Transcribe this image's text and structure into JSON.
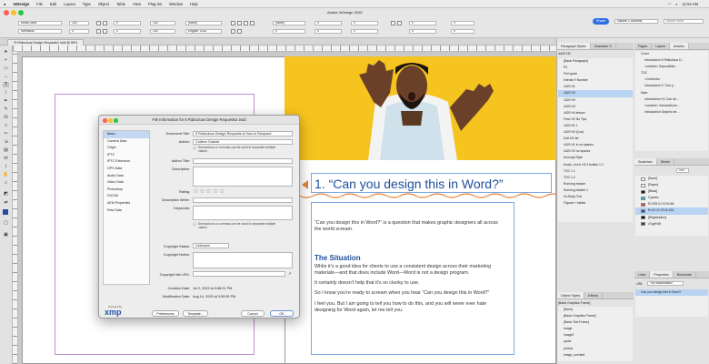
{
  "menubar": {
    "app": "InDesign",
    "items": [
      "File",
      "Edit",
      "Layout",
      "Type",
      "Object",
      "Table",
      "View",
      "Plug-ins",
      "Window",
      "Help"
    ],
    "time": "11:52 AM"
  },
  "control": {
    "title": "Adobe InDesign 2025",
    "font": "Mona Sans",
    "style": "SemiBold",
    "size": "100",
    "leading": "0",
    "lang": "English: USA",
    "none": "[None]",
    "zero": "0",
    "share": "Share",
    "search_ph": "Adobe Stock",
    "workspace": "column 2 columns"
  },
  "doc": {
    "tab": "*5 Ridiculous Design Requests2.indd @ 89%"
  },
  "canvas": {
    "heading": "1. “Can you design this in Word?”",
    "p1a": "“Can you design this in Word?” is a question that makes graphic designers all across",
    "p1b": "the world scream.",
    "subhead": "The Situation",
    "p2a": "While it’s a good idea for clients to use a consistent design across their marketing",
    "p2b": "materials—and that does include Word—Word is not a design program.",
    "p3": "It certainly doesn’t help that it’s so clunky to use.",
    "p4": "So I know you’re ready to scream when you hear “Can you design this in Word?”",
    "p5a": "I feel you. But I am going to tell you how to do this, and you will never ever hate",
    "p5b": "designing for Word again, let me tell you."
  },
  "pstyles": {
    "tabs": [
      "Paragraph Styles",
      "Character S"
    ],
    "header": "4420 H2",
    "items": [
      "[Basic Paragraph]",
      "P4",
      "Pull quote",
      "Interlat H Number",
      "4420 H1",
      "4420 H2",
      "4420 H3",
      "4420 H4",
      "4420 H4 lesson",
      "Fuse H2 No Tips",
      "4420 H1 1",
      "4420 H2 (Con)",
      "Dolt H2 list",
      "4420 H1 in no spaces",
      "4420 H2 no spaces",
      "Koncopt Style",
      "Kuals, List in H3 4 bullets 1.2",
      "TOC 1.1",
      "TOC 1.2",
      "Running header",
      "Running header 1",
      "Ho Body Text",
      "Figures + tables"
    ],
    "selected": 5
  },
  "pages": {
    "tabs": [
      "Pages",
      "Layers",
      "Articles"
    ],
    "items": [
      "Cover",
      "Introduction 5 Ridiculous D...",
      "<content> DepositAbe...",
      "TOC",
      "<Contents>",
      "Introduction 5 \"Can y...",
      "Main",
      "Introduction H1 Can de...",
      "<content> Introductione...",
      "Introduction Graphic de..."
    ]
  },
  "swatches": {
    "tabs": [
      "Swatches",
      "Stroke"
    ],
    "tint": "100",
    "items": [
      {
        "name": "[None]",
        "color": "#ffffff"
      },
      {
        "name": "[Paper]",
        "color": "#ffffff"
      },
      {
        "name": "[Black]",
        "color": "#111111"
      },
      {
        "name": "Cyanes",
        "color": "#22b2c9"
      },
      {
        "name": "R=235 G=70 B=65",
        "color": "#eb4641"
      },
      {
        "name": "R=42 G=75 B=162",
        "color": "#2a4ba2"
      },
      {
        "name": "[Registration]",
        "color": "#000000"
      },
      {
        "name": "oTygRnB",
        "color": "#3b3b3b"
      }
    ],
    "selected": 5
  },
  "props": {
    "tabs": [
      "Links",
      "Properties",
      "Bookmark"
    ],
    "url_label": "URL",
    "url_value": "<no bookmarks>",
    "item": "Can you design this in Word?"
  },
  "ostyles": {
    "tabs": [
      "Object Styles",
      "Effects"
    ],
    "header": "[Basic Graphics Frame]",
    "items": [
      "[None]",
      "[Basic Graphics Frame]",
      "[Basic Text Frame]",
      "Image",
      "Image2",
      "quote",
      "photos",
      "image_overlaid"
    ]
  },
  "dialog": {
    "title": "File Information for 5 Ridiculous Design Requests2.indd",
    "sidebar": [
      "Basic",
      "Camera Data",
      "Origin",
      "IPTC",
      "IPTC Extension",
      "GPS Data",
      "Audio Data",
      "Video Data",
      "Photoshop",
      "DICOM",
      "AEM Properties",
      "Raw Data"
    ],
    "labels": {
      "doc_title": "Document Title:",
      "author": "Author:",
      "author_title": "Author Title:",
      "description": "Description:",
      "rating": "Rating:",
      "desc_writer": "Description Writer:",
      "keywords": "Keywords:",
      "copyright_status": "Copyright Status:",
      "copyright_notice": "Copyright Notice:",
      "copyright_url": "Copyright Info URL:",
      "created": "Creation Date:",
      "modified": "Modification Date:"
    },
    "values": {
      "doc_title": "5 Ridiculous Design Requests & How to Respond",
      "author": "Colleen Gratzer",
      "copyright_status": "Unknown",
      "created": "Jul 2, 2022 at 3:48:21 PM",
      "modified": "Aug 14, 2025 at 3:50:55 PM"
    },
    "hint": "Semicolons or commas can be used to separate multiple values",
    "stars": "☆☆☆☆☆",
    "xmp": "xmp",
    "powered": "Powered By",
    "buttons": {
      "preferences": "Preferences",
      "template": "Template...",
      "cancel": "Cancel",
      "ok": "OK"
    }
  }
}
